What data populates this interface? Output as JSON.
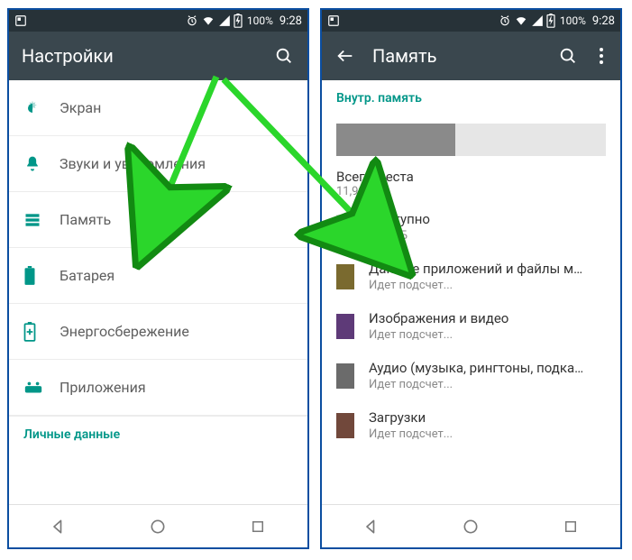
{
  "status": {
    "battery_pct": "100%",
    "clock": "9:28"
  },
  "left": {
    "title": "Настройки",
    "items": [
      {
        "label": "Экран"
      },
      {
        "label": "Звуки и уведомления"
      },
      {
        "label": "Память"
      },
      {
        "label": "Батарея"
      },
      {
        "label": "Энергосбережение"
      },
      {
        "label": "Приложения"
      }
    ],
    "section_header": "Личные данные"
  },
  "right": {
    "title": "Память",
    "section_header": "Внутр. память",
    "total_label": "Всего места",
    "total_value": "11,99 ГБ",
    "rows": [
      {
        "color": "#d9dedc",
        "title": "Доступно",
        "sub": "6,63 ГБ"
      },
      {
        "color": "#7a6a2f",
        "title": "Данные приложений и файлы мул.",
        "sub": "Идет подсчет..."
      },
      {
        "color": "#5e3a78",
        "title": "Изображения и видео",
        "sub": "Идет подсчет..."
      },
      {
        "color": "#6b6b6b",
        "title": "Аудио (музыка, рингтоны, подкаст.",
        "sub": "Идет подсчет..."
      },
      {
        "color": "#71483b",
        "title": "Загрузки",
        "sub": "Идет подсчет..."
      }
    ]
  }
}
